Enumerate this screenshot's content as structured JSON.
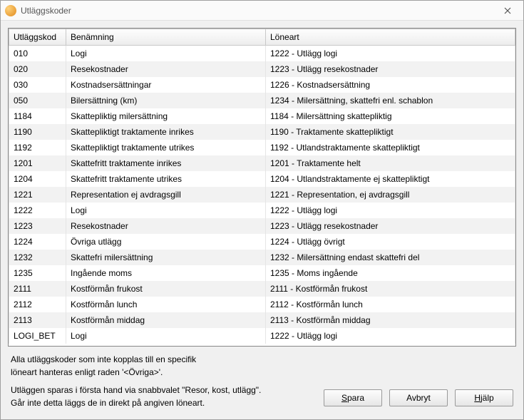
{
  "window": {
    "title": "Utläggskoder"
  },
  "columns": [
    "Utläggskod",
    "Benämning",
    "Löneart"
  ],
  "rows": [
    {
      "kod": "010",
      "ben": "Logi",
      "art": "1222 - Utlägg logi"
    },
    {
      "kod": "020",
      "ben": "Resekostnader",
      "art": "1223 - Utlägg resekostnader"
    },
    {
      "kod": "030",
      "ben": "Kostnadsersättningar",
      "art": "1226 - Kostnadsersättning"
    },
    {
      "kod": "050",
      "ben": "Bilersättning (km)",
      "art": "1234 - Milersättning, skattefri enl. schablon"
    },
    {
      "kod": "1184",
      "ben": "Skattepliktig milersättning",
      "art": "1184 - Milersättning skattepliktig"
    },
    {
      "kod": "1190",
      "ben": "Skattepliktigt traktamente inrikes",
      "art": "1190 - Traktamente skattepliktigt"
    },
    {
      "kod": "1192",
      "ben": "Skattepliktigt traktamente utrikes",
      "art": "1192 - Utlandstraktamente skattepliktigt"
    },
    {
      "kod": "1201",
      "ben": "Skattefritt traktamente inrikes",
      "art": "1201 - Traktamente helt"
    },
    {
      "kod": "1204",
      "ben": "Skattefritt traktamente utrikes",
      "art": "1204 - Utlandstraktamente ej skattepliktigt"
    },
    {
      "kod": "1221",
      "ben": "Representation ej avdragsgill",
      "art": "1221 - Representation, ej avdragsgill"
    },
    {
      "kod": "1222",
      "ben": "Logi",
      "art": "1222 - Utlägg logi"
    },
    {
      "kod": "1223",
      "ben": "Resekostnader",
      "art": "1223 - Utlägg resekostnader"
    },
    {
      "kod": "1224",
      "ben": "Övriga utlägg",
      "art": "1224 - Utlägg övrigt"
    },
    {
      "kod": "1232",
      "ben": "Skattefri milersättning",
      "art": "1232 - Milersättning endast skattefri del"
    },
    {
      "kod": "1235",
      "ben": "Ingående moms",
      "art": "1235 - Moms ingående"
    },
    {
      "kod": "2111",
      "ben": "Kostförmån frukost",
      "art": "2111 - Kostförmån frukost"
    },
    {
      "kod": "2112",
      "ben": "Kostförmån lunch",
      "art": "2112 - Kostförmån lunch"
    },
    {
      "kod": "2113",
      "ben": "Kostförmån middag",
      "art": "2113 - Kostförmån middag"
    },
    {
      "kod": "LOGI_BET",
      "ben": "Logi",
      "art": "1222 - Utlägg logi"
    }
  ],
  "footer": {
    "line1": "Alla utläggskoder som inte kopplas till en specifik",
    "line2": "löneart hanteras enligt raden '<Övriga>'.",
    "line3": "Utläggen sparas i första hand via snabbvalet \"Resor, kost, utlägg\".",
    "line4": "Går inte detta läggs de in direkt på angiven löneart."
  },
  "buttons": {
    "save": "Spara",
    "cancel": "Avbryt",
    "help": "Hjälp"
  }
}
